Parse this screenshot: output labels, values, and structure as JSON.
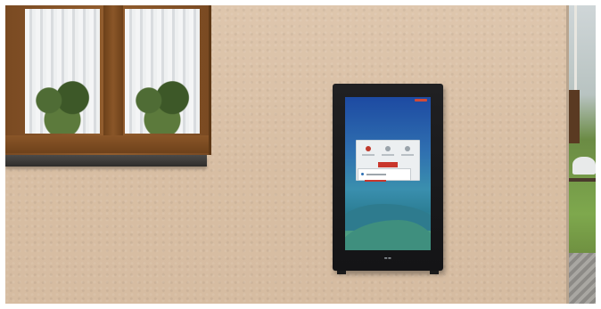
{
  "scene": {
    "description_colors": {
      "wall": "#dcc3a9",
      "window_frame": "#8a5628",
      "kiosk_body": "#1a1a1c",
      "screen_top": "#1d4aa2",
      "screen_bottom": "#6bae7f",
      "dialog_accent": "#c9362b"
    }
  },
  "kiosk": {
    "icons": [
      "close-icon",
      "info-icon",
      "info-icon"
    ],
    "brand_logo": "brand-logo"
  }
}
